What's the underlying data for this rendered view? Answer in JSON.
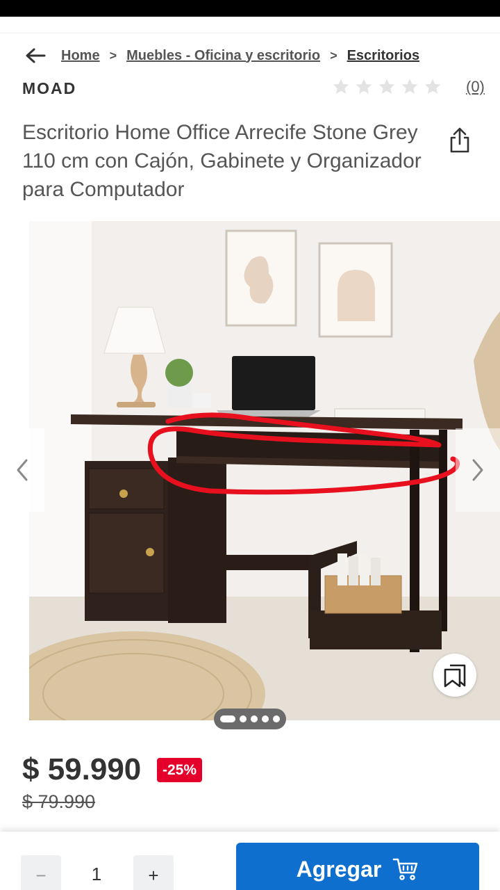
{
  "breadcrumb": {
    "items": [
      {
        "label": "Home"
      },
      {
        "label": "Muebles - Oficina y escritorio"
      },
      {
        "label": "Escritorios"
      }
    ],
    "separator": ">"
  },
  "product": {
    "brand": "MOAD",
    "rating_stars": 0,
    "rating_max": 5,
    "review_count": "(0)",
    "title": "Escritorio Home Office Arrecife Stone Grey 110 cm con Cajón, Gabinete y Organizador para Computador",
    "price": "$ 59.990",
    "discount": "-25%",
    "old_price": "$ 79.990"
  },
  "gallery": {
    "image_count": 5,
    "active_index": 0
  },
  "cart": {
    "quantity": "1",
    "minus_label": "−",
    "plus_label": "+",
    "add_label": "Agregar"
  },
  "colors": {
    "accent": "#0f6fcf",
    "discount": "#e4002b",
    "annotation": "#e8101e"
  },
  "icons": [
    "back-arrow-icon",
    "star-icon",
    "share-icon",
    "chevron-left-icon",
    "chevron-right-icon",
    "bookmark-collection-icon",
    "cart-icon"
  ]
}
